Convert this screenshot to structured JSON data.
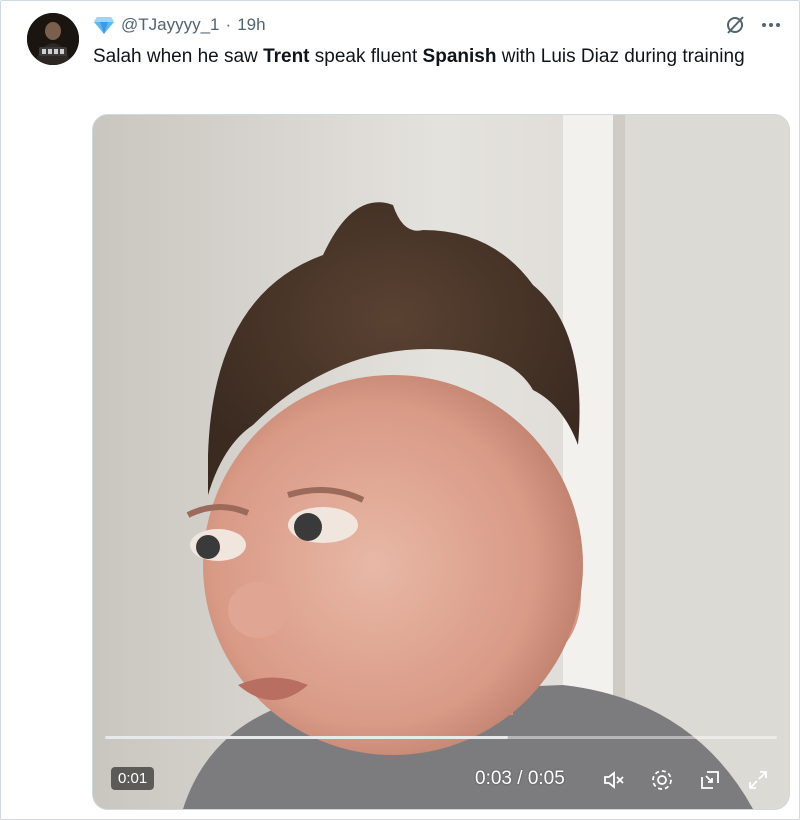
{
  "tweet": {
    "author_handle": "@TJayyyy_1",
    "separator": "·",
    "timestamp": "19h",
    "text_parts": [
      {
        "t": "Salah when he saw ",
        "bold": false
      },
      {
        "t": "Trent",
        "bold": true
      },
      {
        "t": " speak fluent ",
        "bold": false
      },
      {
        "t": "Spanish",
        "bold": true
      },
      {
        "t": " with Luis Diaz during training",
        "bold": false
      }
    ],
    "badge_icon": "diamond-icon",
    "badge_color": "#4aa8e8"
  },
  "video": {
    "elapsed_badge": "0:01",
    "time_readout": "0:03 / 0:05",
    "progress_fraction": 0.6,
    "muted": true
  },
  "icons": {
    "grok": "slashed-circle-icon",
    "more": "more-dots-icon",
    "mute": "speaker-muted-icon",
    "settings": "gear-icon",
    "pip": "picture-in-picture-icon",
    "fullscreen": "expand-icon"
  }
}
